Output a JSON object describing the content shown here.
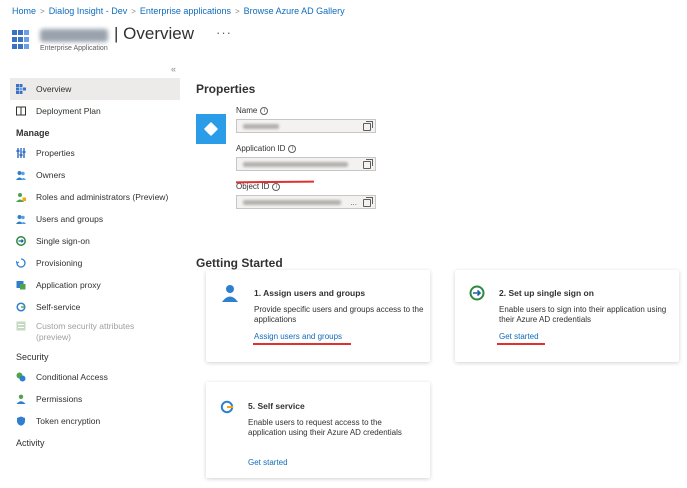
{
  "breadcrumb": [
    "Home",
    "Dialog Insight - Dev",
    "Enterprise applications",
    "Browse Azure AD Gallery"
  ],
  "header": {
    "title": "| Overview",
    "more": "···",
    "subtitle": "Enterprise Application"
  },
  "sidebar": {
    "collapse": "«",
    "items_top": [
      {
        "label": "Overview",
        "icon": "overview-grid-icon",
        "color": "#3a72c4"
      },
      {
        "label": "Deployment Plan",
        "icon": "book-icon",
        "color": "#323130"
      }
    ],
    "manage_title": "Manage",
    "manage_items": [
      {
        "label": "Properties",
        "icon": "properties-icon",
        "color": "#3a72c4"
      },
      {
        "label": "Owners",
        "icon": "owners-icon",
        "color": "#2f7fd1"
      },
      {
        "label": "Roles and administrators (Preview)",
        "icon": "roles-icon",
        "color": "#4fa34a"
      },
      {
        "label": "Users and groups",
        "icon": "users-icon",
        "color": "#2f7fd1"
      },
      {
        "label": "Single sign-on",
        "icon": "sso-icon",
        "color": "#2b8a3e"
      },
      {
        "label": "Provisioning",
        "icon": "provisioning-icon",
        "color": "#2f7fd1"
      },
      {
        "label": "Application proxy",
        "icon": "app-proxy-icon",
        "color": "#2f7fd1"
      },
      {
        "label": "Self-service",
        "icon": "self-service-icon",
        "color": "#2f7fd1"
      }
    ],
    "custom_attr": {
      "line1": "Custom security attributes",
      "line2": "(preview)"
    },
    "security_title": "Security",
    "security_items": [
      {
        "label": "Conditional Access",
        "icon": "conditional-access-icon",
        "color": "#4fa34a"
      },
      {
        "label": "Permissions",
        "icon": "permissions-icon",
        "color": "#4fa34a"
      },
      {
        "label": "Token encryption",
        "icon": "shield-icon",
        "color": "#2f7fd1"
      }
    ],
    "activity_title": "Activity"
  },
  "properties": {
    "heading": "Properties",
    "name_label": "Name",
    "app_id_label": "Application ID",
    "object_id_label": "Object ID",
    "ellipsis": "..."
  },
  "getting_started": {
    "heading": "Getting Started",
    "cards": [
      {
        "title": "1. Assign users and groups",
        "desc": "Provide specific users and groups access to the applications",
        "link": "Assign users and groups"
      },
      {
        "title": "2. Set up single sign on",
        "desc": "Enable users to sign into their application using their Azure AD credentials",
        "link": "Get started"
      },
      {
        "title": "5. Self service",
        "desc": "Enable users to request access to the application using their Azure AD credentials",
        "link": "Get started"
      }
    ]
  },
  "colors": {
    "link": "#0f6cbd",
    "accent": "#2b9de8",
    "annotation_red": "#e0302f"
  }
}
